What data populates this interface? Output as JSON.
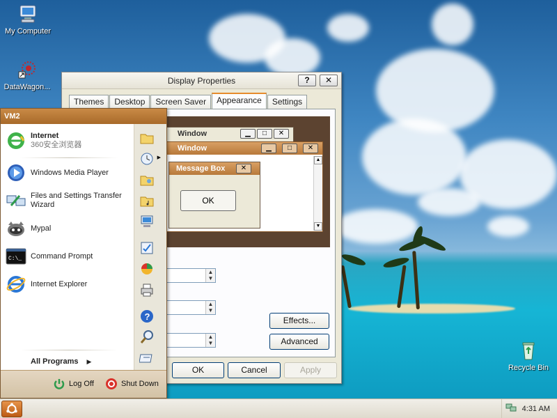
{
  "desktop": {
    "icons": [
      {
        "label": "My Computer",
        "icon": "my-computer-icon"
      },
      {
        "label": "DataWagon...",
        "icon": "datawagon-icon"
      },
      {
        "label": "Recycle Bin",
        "icon": "recycle-bin-icon"
      }
    ]
  },
  "display_properties": {
    "title": "Display Properties",
    "help_label": "?",
    "close_label": "✕",
    "tabs": [
      "Themes",
      "Desktop",
      "Screen Saver",
      "Appearance",
      "Settings"
    ],
    "active_tab": "Appearance",
    "preview": {
      "inactive_window_title": "Window",
      "active_window_title": "Window",
      "message_box_title": "Message Box",
      "ok_label": "OK"
    },
    "buttons": {
      "effects": "Effects...",
      "advanced": "Advanced",
      "ok": "OK",
      "cancel": "Cancel",
      "apply": "Apply"
    }
  },
  "start_menu": {
    "user": "VM2",
    "pinned": [
      {
        "title": "Internet",
        "subtitle": "360安全浏览器",
        "icon": "360-browser-icon"
      }
    ],
    "items": [
      {
        "label": "Windows Media Player",
        "icon": "media-player-icon"
      },
      {
        "label": "Files and Settings Transfer Wizard",
        "icon": "transfer-wizard-icon"
      },
      {
        "label": "Mypal",
        "icon": "mypal-icon"
      },
      {
        "label": "Command Prompt",
        "icon": "command-prompt-icon"
      },
      {
        "label": "Internet Explorer",
        "icon": "internet-explorer-icon"
      }
    ],
    "all_programs": "All Programs",
    "log_off": "Log Off",
    "shut_down": "Shut Down",
    "right_icons": [
      "documents-icon",
      "recent-icon",
      "pictures-icon",
      "music-icon",
      "computer-icon",
      "control-panel-icon",
      "programs-icon",
      "printers-icon",
      "help-icon",
      "search-icon",
      "run-icon"
    ]
  },
  "taskbar": {
    "clock": "4:31 AM"
  },
  "colors": {
    "accent": "#c98a46",
    "tab_highlight": "#e68b2c",
    "dialog_bg": "#ece9d8"
  }
}
